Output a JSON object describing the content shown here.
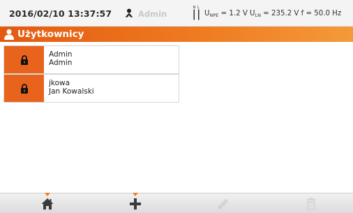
{
  "status": {
    "datetime": "2016/02/10 13:37:57",
    "current_user": "Admin",
    "measurement": {
      "unpe_label": "U",
      "unpe_sub": "NPE",
      "unpe_value": "= 1.2 V",
      "uln_label": "U",
      "uln_sub": "LN",
      "uln_value": "= 235.2 V",
      "f_text": "f = 50.0 Hz"
    },
    "nl_icon_letters": [
      "N",
      "L"
    ]
  },
  "header": {
    "title": "Użytkownicy"
  },
  "users": [
    {
      "login": "Admin",
      "name": "Admin"
    },
    {
      "login": "jkowa",
      "name": "Jan Kowalski"
    }
  ],
  "colors": {
    "accent": "#f07d22",
    "accent_dark": "#e35a10",
    "disabled": "#c8c8c8"
  },
  "icons": {
    "user": "user-icon",
    "lock": "lock-icon",
    "home": "home-icon",
    "add": "plus-icon",
    "edit": "pencil-icon",
    "delete": "trash-icon"
  }
}
